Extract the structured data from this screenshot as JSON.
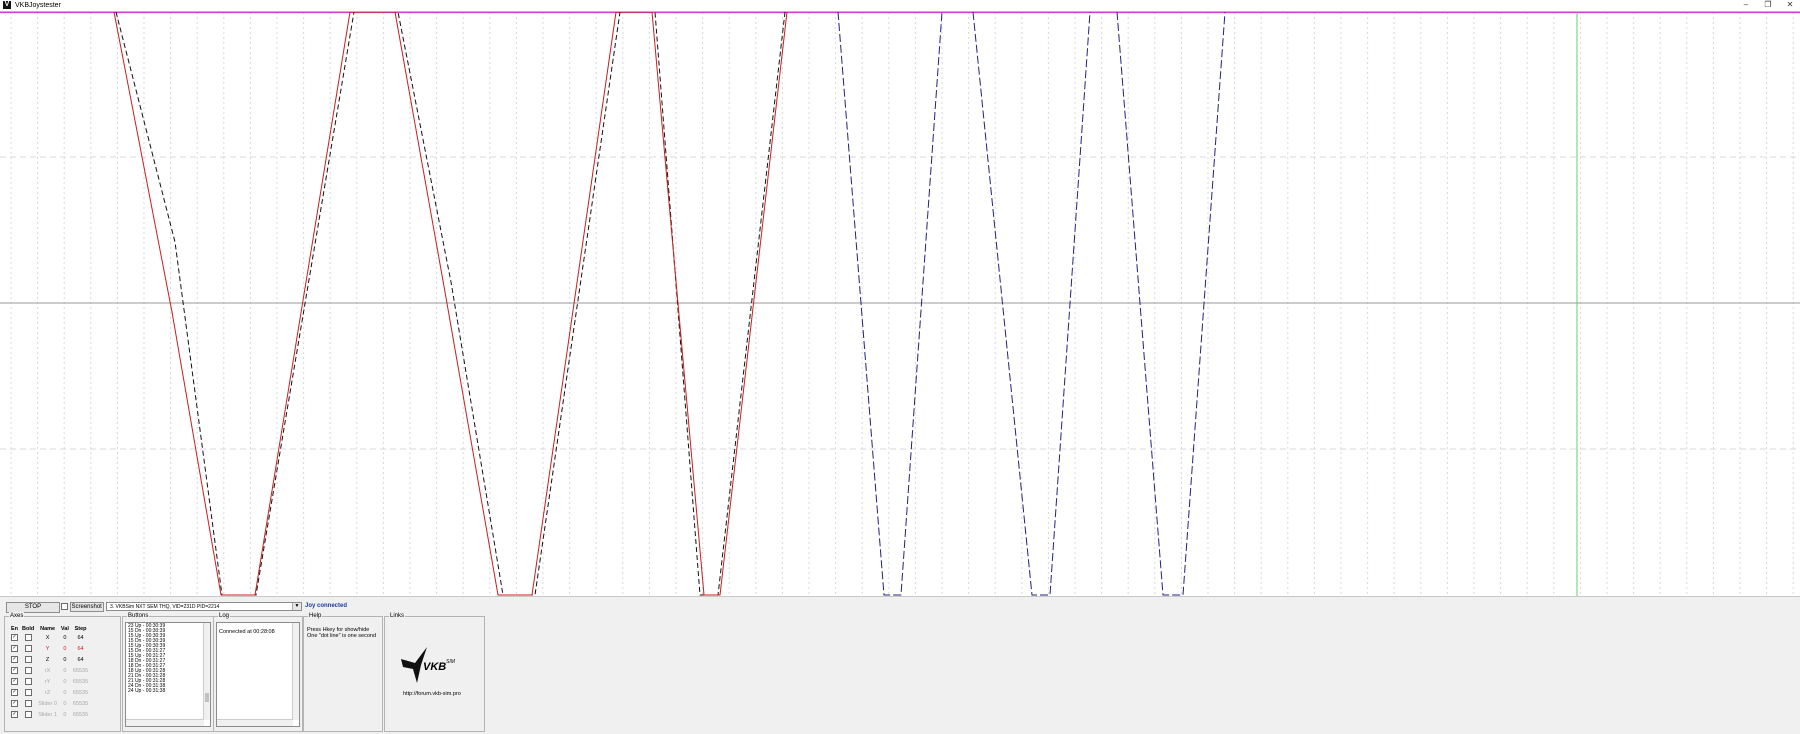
{
  "window": {
    "title": "VKBJoystester",
    "min": "–",
    "max": "❐",
    "close": "✕"
  },
  "colors": {
    "red": "#c81e1e",
    "black": "#111111",
    "navy": "#22227a",
    "magenta": "#d040d0",
    "green": "#66cc66"
  },
  "controls": {
    "stop_label": "STOP",
    "screenshot_label": "Screenshot",
    "device_selected": "3. VKBSim NXT SEM THQ, VID=231D PID=2214",
    "status": "Joy connected"
  },
  "axes": {
    "title": "Axes",
    "headers": [
      "En",
      "Bold",
      "Name",
      "Val",
      "Step"
    ],
    "rows": [
      {
        "en": true,
        "bold": false,
        "name": "X",
        "val": "0",
        "step": "64"
      },
      {
        "en": true,
        "bold": false,
        "name": "Y",
        "val": "0",
        "step": "64"
      },
      {
        "en": true,
        "bold": false,
        "name": "Z",
        "val": "0",
        "step": "64"
      },
      {
        "en": true,
        "bold": false,
        "name": "rX",
        "val": "0",
        "step": "65535"
      },
      {
        "en": true,
        "bold": false,
        "name": "rY",
        "val": "0",
        "step": "65535"
      },
      {
        "en": true,
        "bold": false,
        "name": "rZ",
        "val": "0",
        "step": "65535"
      },
      {
        "en": true,
        "bold": false,
        "name": "Slider 0",
        "val": "0",
        "step": "65535"
      },
      {
        "en": true,
        "bold": false,
        "name": "Slider 1",
        "val": "0",
        "step": "65535"
      }
    ]
  },
  "buttons": {
    "title": "Buttons",
    "items": [
      "23 Up - 00:30:39",
      "15 Dn - 00:30:39",
      "15 Up - 00:30:39",
      "15 Dn - 00:30:39",
      "15 Up - 00:30:39",
      "15 Dn - 00:31:27",
      "15 Up - 00:31:27",
      "18 Dn - 00:31:27",
      "18 Dn - 00:31:27",
      "18 Up - 00:31:28",
      "21 Dn - 00:31:28",
      "21 Up - 00:31:28",
      "24 Dn - 00:31:38",
      "24 Up - 00:31:38"
    ]
  },
  "log": {
    "title": "Log",
    "text": "Connected at 00:28:08"
  },
  "help": {
    "title": "Help",
    "line1": "Press Hkey for show/hide",
    "line2": "One \"dot line\" is one second"
  },
  "links": {
    "title": "Links",
    "logo": "VKB",
    "logo_sub": "SIM",
    "url": "http://forum.vkb-sim.pro"
  }
}
